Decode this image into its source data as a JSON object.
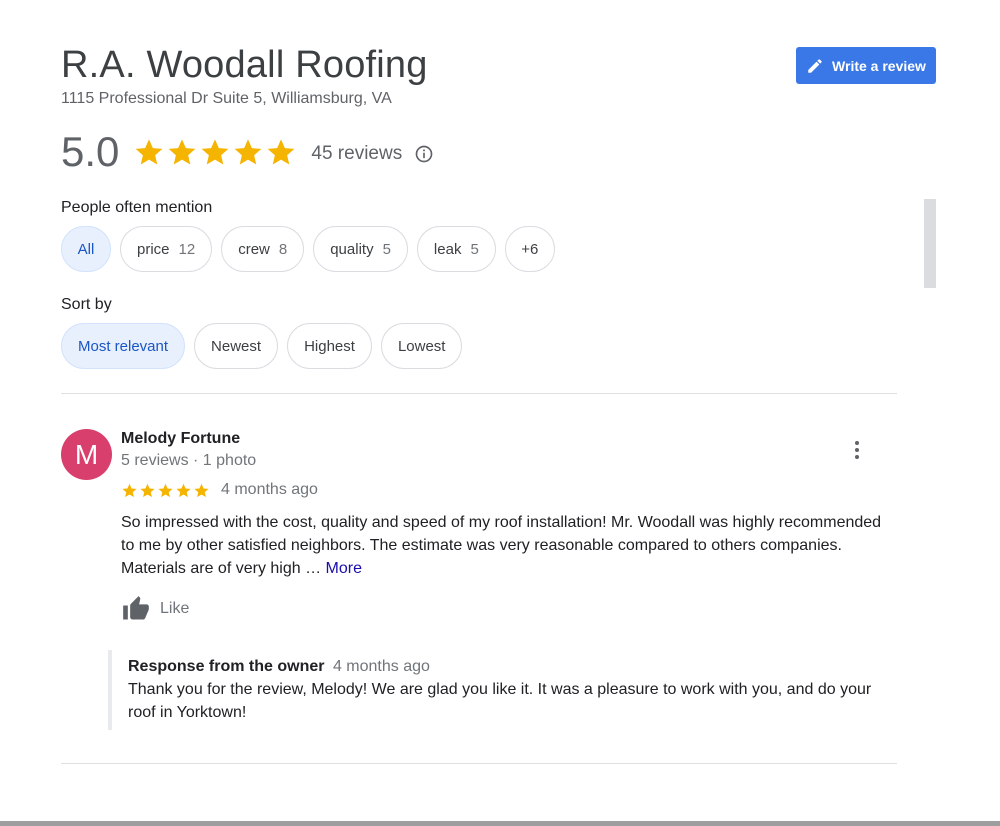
{
  "business": {
    "name": "R.A. Woodall Roofing",
    "address": "1115 Professional Dr Suite 5, Williamsburg, VA"
  },
  "write_review": {
    "label": "Write a review",
    "icon": "pencil-icon"
  },
  "rating": {
    "value": "5.0",
    "stars": 5,
    "review_count": "45 reviews",
    "info_icon": "info-icon"
  },
  "mentions": {
    "label": "People often mention",
    "chips": [
      {
        "label": "All",
        "count": "",
        "selected": true
      },
      {
        "label": "price",
        "count": "12"
      },
      {
        "label": "crew",
        "count": "8"
      },
      {
        "label": "quality",
        "count": "5"
      },
      {
        "label": "leak",
        "count": "5"
      },
      {
        "label": "+6",
        "count": ""
      }
    ]
  },
  "sort": {
    "label": "Sort by",
    "options": [
      {
        "label": "Most relevant",
        "selected": true
      },
      {
        "label": "Newest"
      },
      {
        "label": "Highest"
      },
      {
        "label": "Lowest"
      }
    ]
  },
  "review": {
    "avatar_letter": "M",
    "avatar_color": "#d93f6c",
    "name": "Melody Fortune",
    "meta": "5 reviews · 1 photo",
    "stars": 5,
    "age": "4 months ago",
    "text": "So impressed with the cost, quality and speed of my roof installation!  Mr. Woodall was highly recommended to me by other satisfied neighbors. The estimate was very reasonable compared to others companies.  Materials are of very high …",
    "more": "More",
    "like": "Like",
    "owner_response": {
      "title": "Response from the owner",
      "age": "4 months ago",
      "text": "Thank you for the review, Melody! We are glad you like it. It was a pleasure to work with you, and do your roof in Yorktown!"
    }
  },
  "colors": {
    "star": "#f4b400",
    "accent": "#3a78e7",
    "link": "#1a0dab",
    "chip_selected_bg": "#e8f0fe"
  }
}
